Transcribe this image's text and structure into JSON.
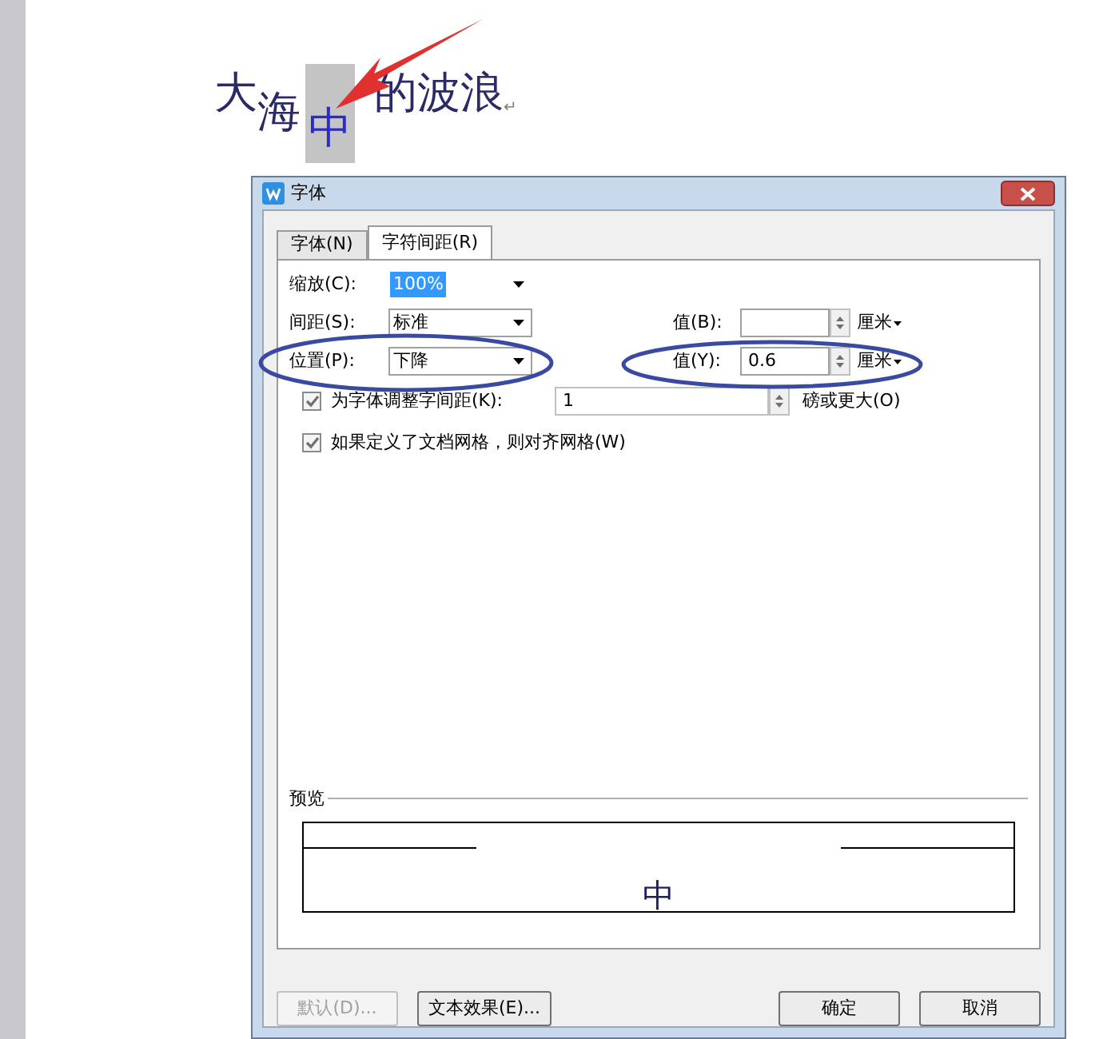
{
  "document": {
    "runs": [
      {
        "text": "大",
        "kind": "plain",
        "selected": false
      },
      {
        "text": "海",
        "kind": "dropped",
        "selected": false
      },
      {
        "text": "中",
        "kind": "lowered",
        "selected": true
      },
      {
        "text": "的波浪",
        "kind": "plain",
        "selected": false
      }
    ],
    "paragraph_mark": "↵"
  },
  "dialog": {
    "title": "字体",
    "tabs": [
      {
        "label": "字体(N)",
        "selected": false
      },
      {
        "label": "字符间距(R)",
        "selected": true
      }
    ],
    "rows": [
      {
        "label": "缩放(C):",
        "value": "100%",
        "highlighted": true
      },
      {
        "label": "间距(S):",
        "value": "标准",
        "highlighted": false,
        "spin_label": "值(B):",
        "spin_value": "",
        "unit": "厘米"
      },
      {
        "label": "位置(P):",
        "value": "下降",
        "highlighted": false,
        "spin_label": "值(Y):",
        "spin_value": "0.6",
        "unit": "厘米"
      }
    ],
    "checks": [
      {
        "label": "为字体调整字间距(K):",
        "checked": true,
        "spin_value": "1",
        "suffix": "磅或更大(O)"
      },
      {
        "label": "如果定义了文档网格，则对齐网格(W)",
        "checked": true
      }
    ],
    "preview": {
      "label": "预览",
      "sample": "中"
    },
    "buttons": [
      {
        "label": "默认(D)...",
        "disabled": true,
        "kind": "left"
      },
      {
        "label": "文本效果(E)...",
        "disabled": false,
        "kind": "left"
      },
      {
        "label": "确定",
        "disabled": false,
        "kind": "right"
      },
      {
        "label": "取消",
        "disabled": false,
        "kind": "right"
      }
    ]
  }
}
